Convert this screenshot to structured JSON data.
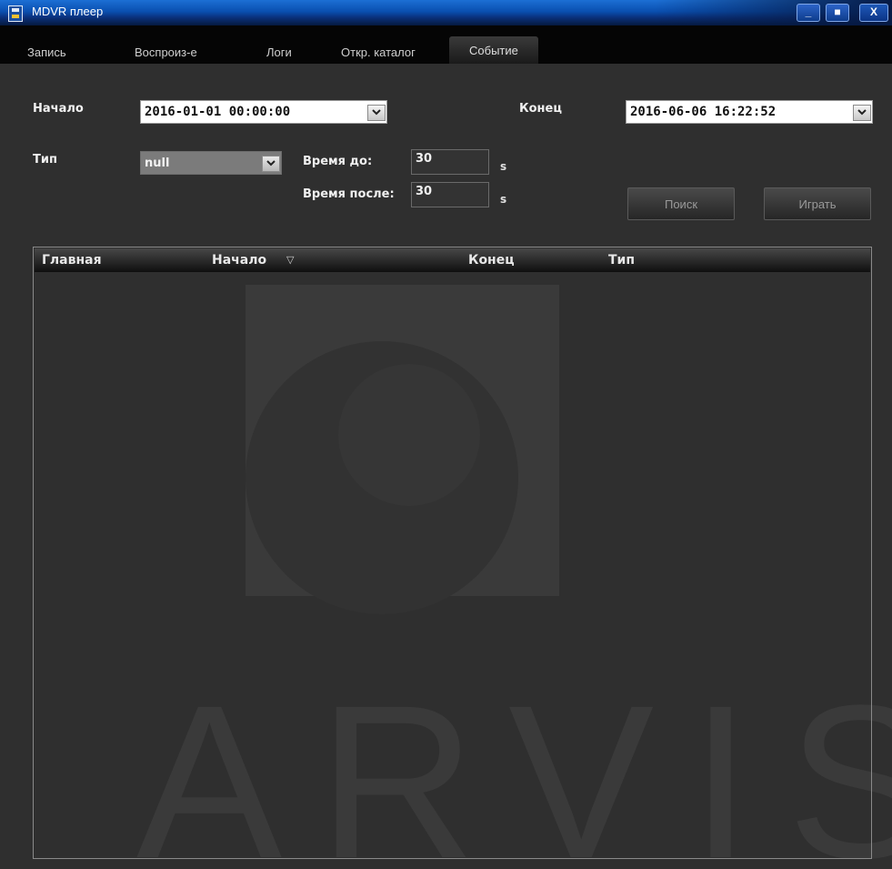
{
  "window": {
    "title": "MDVR плеер",
    "buttons": {
      "minimize": "_",
      "maximize": "■",
      "close": "X"
    }
  },
  "menu": {
    "items": [
      {
        "label": "Запись"
      },
      {
        "label": "Воспроиз-е"
      },
      {
        "label": "Логи"
      },
      {
        "label": "Откр. каталог"
      },
      {
        "label": "Событие",
        "active": true
      }
    ]
  },
  "form": {
    "start_label": "Начало",
    "start_value": "2016-01-01 00:00:00",
    "end_label": "Конец",
    "end_value": "2016-06-06 16:22:52",
    "type_label": "Тип",
    "type_value": "null",
    "time_before_label": "Время до:",
    "time_before_value": "30",
    "time_after_label": "Время после:",
    "time_after_value": "30",
    "unit": "s",
    "search_button": "Поиск",
    "play_button": "Играть"
  },
  "table": {
    "columns": [
      "Главная",
      "Начало",
      "Конец",
      "Тип"
    ],
    "sort_indicator": "▽",
    "rows": []
  },
  "watermark": {
    "text": "ARVIS"
  },
  "colors": {
    "background": "#2f2f2f",
    "titlebar": "#0a4fb0",
    "menubar": "#050505"
  }
}
